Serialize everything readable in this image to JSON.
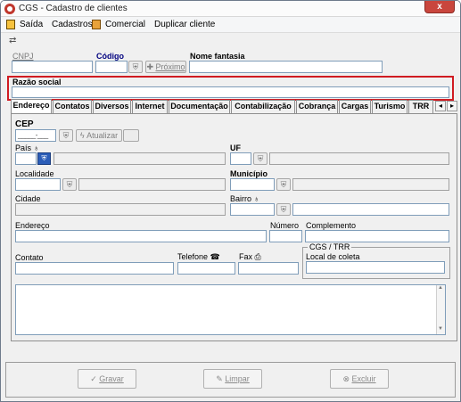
{
  "window": {
    "title": "CGS - Cadastro de clientes",
    "close": "x"
  },
  "menu": {
    "items": [
      "Saída",
      "Cadastros",
      "Comercial",
      "Duplicar cliente"
    ]
  },
  "header": {
    "cnpj_label": "CNPJ",
    "codigo_label": "Código",
    "nome_fantasia_label": "Nome fantasia",
    "proximo_label": "Próximo",
    "razao_social_label": "Razão social"
  },
  "tabs": [
    "Endereço",
    "Contatos",
    "Diversos",
    "Internet",
    "Documentação",
    "Contabilização",
    "Cobrança",
    "Cargas",
    "Turismo",
    "TRR"
  ],
  "tabs_active": "Endereço",
  "address": {
    "cep_label": "CEP",
    "cep_mask": "_____-___",
    "atualizar_label": "Atualizar",
    "pais_label": "País",
    "uf_label": "UF",
    "localidade_label": "Localidade",
    "municipio_label": "Município",
    "cidade_label": "Cidade",
    "bairro_label": "Bairro",
    "endereco_label": "Endereço",
    "numero_label": "Número",
    "complemento_label": "Complemento",
    "contato_label": "Contato",
    "telefone_label": "Telefone",
    "fax_label": "Fax",
    "cgs_trr_label": "CGS / TRR",
    "local_coleta_label": "Local de coleta"
  },
  "footer": {
    "gravar": "Gravar",
    "limpar": "Limpar",
    "excluir": "Excluir"
  },
  "colors": {
    "highlight": "#d01b22",
    "code_label": "#00007f",
    "close": "#c9463d"
  }
}
